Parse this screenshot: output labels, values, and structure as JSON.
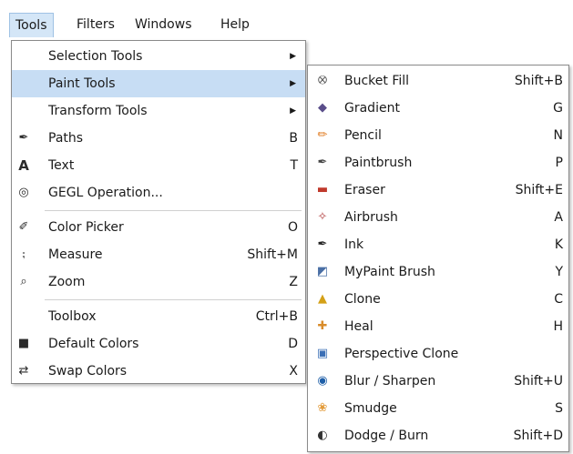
{
  "menubar": [
    "Tools",
    "Filters",
    "Windows",
    "Help"
  ],
  "tools_menu": [
    {
      "label": "Selection Tools",
      "shortcut": "",
      "icon": "",
      "submenu": true
    },
    {
      "label": "Paint Tools",
      "shortcut": "",
      "icon": "",
      "submenu": true,
      "highlighted": true
    },
    {
      "label": "Transform Tools",
      "shortcut": "",
      "icon": "",
      "submenu": true
    },
    {
      "label": "Paths",
      "shortcut": "B",
      "icon": "paths-icon"
    },
    {
      "label": "Text",
      "shortcut": "T",
      "icon": "text-icon"
    },
    {
      "label": "GEGL Operation...",
      "shortcut": "",
      "icon": "gegl-icon",
      "separator_after": true
    },
    {
      "label": "Color Picker",
      "shortcut": "O",
      "icon": "color-picker-icon"
    },
    {
      "label": "Measure",
      "shortcut": "Shift+M",
      "icon": "measure-icon"
    },
    {
      "label": "Zoom",
      "shortcut": "Z",
      "icon": "zoom-icon",
      "separator_after": true
    },
    {
      "label": "Toolbox",
      "shortcut": "Ctrl+B",
      "icon": ""
    },
    {
      "label": "Default Colors",
      "shortcut": "D",
      "icon": "default-colors-icon"
    },
    {
      "label": "Swap Colors",
      "shortcut": "X",
      "icon": "swap-colors-icon"
    }
  ],
  "paint_tools_menu": [
    {
      "label": "Bucket Fill",
      "shortcut": "Shift+B",
      "icon": "bucket-fill-icon",
      "color": "#555555"
    },
    {
      "label": "Gradient",
      "shortcut": "G",
      "icon": "gradient-icon",
      "color": "#5a4e8a"
    },
    {
      "label": "Pencil",
      "shortcut": "N",
      "icon": "pencil-icon",
      "color": "#e07a1f"
    },
    {
      "label": "Paintbrush",
      "shortcut": "P",
      "icon": "paintbrush-icon",
      "color": "#444444"
    },
    {
      "label": "Eraser",
      "shortcut": "Shift+E",
      "icon": "eraser-icon",
      "color": "#c0392b"
    },
    {
      "label": "Airbrush",
      "shortcut": "A",
      "icon": "airbrush-icon",
      "color": "#b03a3a"
    },
    {
      "label": "Ink",
      "shortcut": "K",
      "icon": "ink-icon",
      "color": "#222222"
    },
    {
      "label": "MyPaint Brush",
      "shortcut": "Y",
      "icon": "mypaint-brush-icon",
      "color": "#4a6fa5"
    },
    {
      "label": "Clone",
      "shortcut": "C",
      "icon": "clone-icon",
      "color": "#d4a017"
    },
    {
      "label": "Heal",
      "shortcut": "H",
      "icon": "heal-icon",
      "color": "#d98c2b"
    },
    {
      "label": "Perspective Clone",
      "shortcut": "",
      "icon": "perspective-clone-icon",
      "color": "#3b6fb6"
    },
    {
      "label": "Blur / Sharpen",
      "shortcut": "Shift+U",
      "icon": "blur-sharpen-icon",
      "color": "#1f5fa8"
    },
    {
      "label": "Smudge",
      "shortcut": "S",
      "icon": "smudge-icon",
      "color": "#e39b3a"
    },
    {
      "label": "Dodge / Burn",
      "shortcut": "Shift+D",
      "icon": "dodge-burn-icon",
      "color": "#333333"
    }
  ],
  "colors": {
    "highlight": "#c7ddf4",
    "menu_border": "#8a8a8a",
    "separator": "#d0d0d0"
  }
}
